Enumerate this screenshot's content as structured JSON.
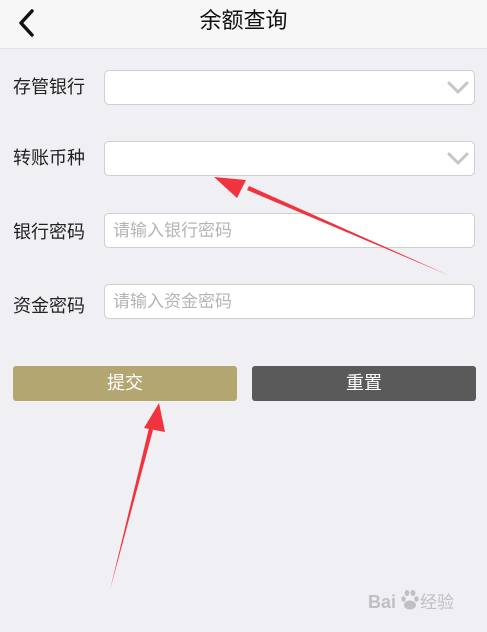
{
  "header": {
    "title": "余额查询",
    "back_icon": "chevron-left-icon"
  },
  "form": {
    "custody_bank": {
      "label": "存管银行",
      "value": "",
      "icon": "chevron-down-icon"
    },
    "currency": {
      "label": "转账币种",
      "value": "",
      "icon": "chevron-down-icon"
    },
    "bank_password": {
      "label": "银行密码",
      "placeholder": "请输入银行密码",
      "value": ""
    },
    "fund_password": {
      "label": "资金密码",
      "placeholder": "请输入资金密码",
      "value": ""
    }
  },
  "actions": {
    "submit_label": "提交",
    "reset_label": "重置"
  },
  "colors": {
    "page_background": "#efeff4",
    "submit_button": "#b3a670",
    "reset_button": "#5a5a5a",
    "annotation_arrow": "#f0333c"
  },
  "watermark": {
    "text": "Baidu经验"
  }
}
